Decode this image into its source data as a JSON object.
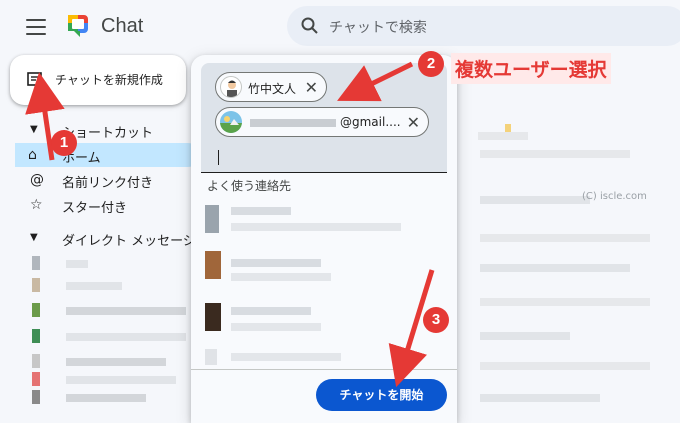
{
  "header": {
    "app_title": "Chat",
    "search_placeholder": "チャットで検索"
  },
  "new_chat_button": {
    "label": "チャットを新規作成"
  },
  "sidebar": {
    "shortcuts_header": "ショートカット",
    "items": [
      {
        "label": "ホーム",
        "icon": "home-icon"
      },
      {
        "label": "名前リンク付き",
        "icon": "at-icon"
      },
      {
        "label": "スター付き",
        "icon": "star-icon"
      }
    ],
    "dm_header": "ダイレクト メッセージ"
  },
  "dialog": {
    "chips": [
      {
        "name": "竹中文人"
      },
      {
        "name": "@gmail...."
      }
    ],
    "section_title": "よく使う連絡先",
    "start_button": "チャットを開始"
  },
  "annotations": {
    "badge1": "1",
    "badge2": "2",
    "badge3": "3",
    "label2": "複数ユーザー選択",
    "color": "#e53935"
  },
  "watermark": "(C) iscle.com",
  "colors": {
    "accent": "#0b57d0",
    "selected_bg": "#c2e7ff",
    "annotation": "#e53935"
  }
}
